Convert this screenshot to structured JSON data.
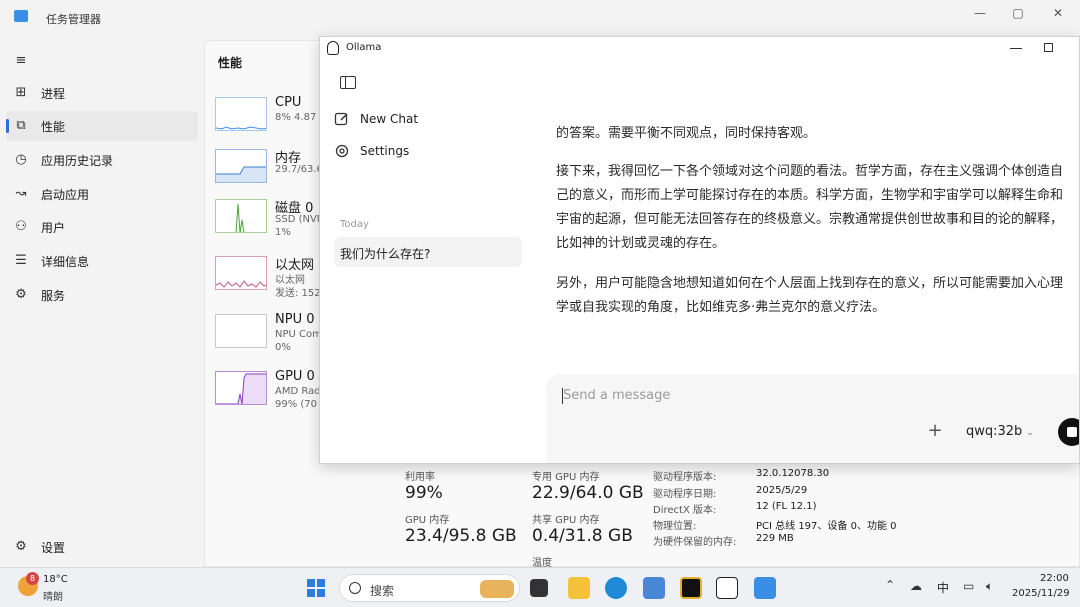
{
  "task_manager": {
    "title": "任务管理器",
    "window_controls": [
      "—",
      "▢",
      "✕"
    ],
    "nav": [
      {
        "label": "进程",
        "icon": "processes-icon"
      },
      {
        "label": "性能",
        "icon": "performance-icon",
        "active": true
      },
      {
        "label": "应用历史记录",
        "icon": "app-history-icon"
      },
      {
        "label": "启动应用",
        "icon": "startup-icon"
      },
      {
        "label": "用户",
        "icon": "users-icon"
      },
      {
        "label": "详细信息",
        "icon": "details-icon"
      },
      {
        "label": "服务",
        "icon": "services-icon"
      }
    ],
    "settings_label": "设置",
    "perf_title": "性能",
    "perf_items": [
      {
        "name": "CPU",
        "sub1": "8% 4.87",
        "sub2": ""
      },
      {
        "name": "内存",
        "sub1": "29.7/63.6",
        "sub2": ""
      },
      {
        "name": "磁盘 0",
        "sub1": "SSD (NVM",
        "sub2": "1%"
      },
      {
        "name": "以太网",
        "sub1": "以太网",
        "sub2": "发送: 152"
      },
      {
        "name": "NPU 0",
        "sub1": "NPU Com",
        "sub2": "0%"
      },
      {
        "name": "GPU 0",
        "sub1": "AMD Rad",
        "sub2": "99% (70"
      }
    ],
    "gpu_stats": {
      "utilization_label": "利用率",
      "utilization": "99%",
      "dedicated_label": "专用 GPU 内存",
      "dedicated": "22.9/64.0 GB",
      "gpu_mem_label": "GPU 内存",
      "gpu_mem": "23.4/95.8 GB",
      "shared_label": "共享 GPU 内存",
      "shared": "0.4/31.8 GB",
      "temp_label": "温度"
    },
    "driver_info": [
      {
        "k": "驱动程序版本:",
        "v": "32.0.12078.30"
      },
      {
        "k": "驱动程序日期:",
        "v": "2025/5/29"
      },
      {
        "k": "DirectX 版本:",
        "v": "12 (FL 12.1)"
      },
      {
        "k": "物理位置:",
        "v": "PCI 总线 197、设备 0、功能 0"
      },
      {
        "k": "为硬件保留的内存:",
        "v": "229 MB"
      }
    ]
  },
  "ollama": {
    "title": "Ollama",
    "new_chat": "New Chat",
    "settings": "Settings",
    "today_label": "Today",
    "conversation": "我们为什么存在?",
    "paragraphs": [
      [
        "的答案。需要平衡不同观点，同时保持客观。"
      ],
      [
        "接下来，我得回忆一下各个领域对这个问题的看法。哲学方面，存在主义强调个体创造自",
        "己的意义，而形而上学可能探讨存在的本质。科学方面，生物学和宇宙学可以解释生命和",
        "宇宙的起源，但可能无法回答存在的终极意义。宗教通常提供创世故事和目的论的解释，",
        "比如神的计划或灵魂的存在。"
      ],
      [
        "另外，用户可能隐含地想知道如何在个人层面上找到存在的意义，所以可能需要加入心理",
        "学或自我实现的角度，比如维克多·弗兰克尔的意义疗法。"
      ]
    ],
    "input_placeholder": "Send a message",
    "model": "qwq:32b"
  },
  "taskbar": {
    "weather_badge": "8",
    "temperature": "18°C",
    "weather": "晴朗",
    "search_label": "搜索",
    "ime": "中",
    "time": "22:00",
    "date": "2025/11/29"
  }
}
